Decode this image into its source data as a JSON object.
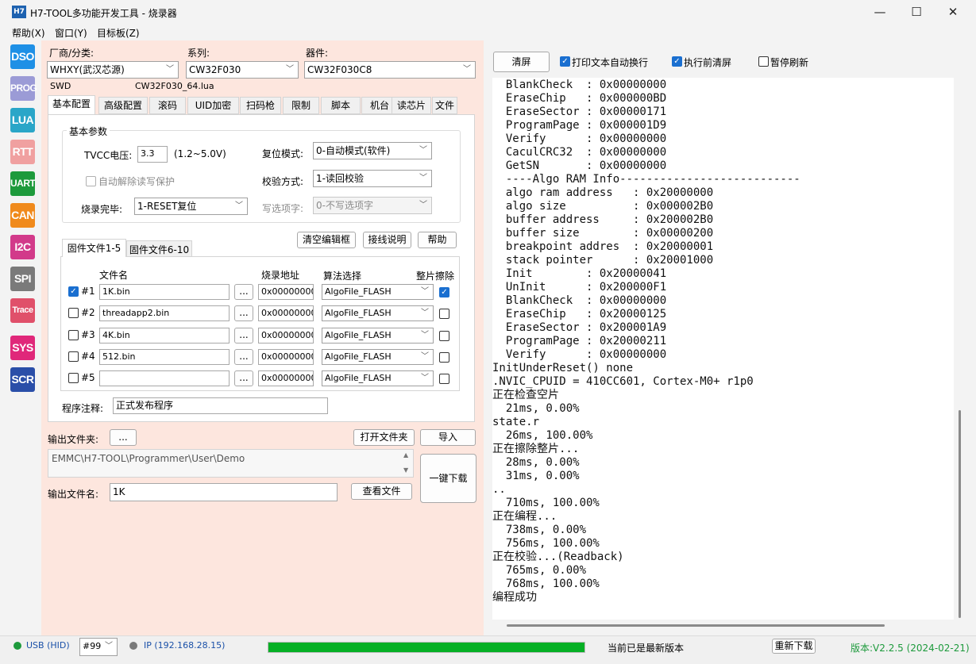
{
  "window": {
    "app_icon": "H7",
    "title": "H7-TOOL多功能开发工具 - 烧录器",
    "minimize": "—",
    "maximize": "☐",
    "close": "✕"
  },
  "menu": [
    "帮助(X)",
    "窗口(Y)",
    "目标板(Z)"
  ],
  "side_buttons": [
    {
      "label": "DSO",
      "color": "#1e90e6"
    },
    {
      "label": "PROG",
      "color": "#9b9bd6"
    },
    {
      "label": "LUA",
      "color": "#2aa6c8"
    },
    {
      "label": "RTT",
      "color": "#f0a0a0"
    },
    {
      "label": "UART",
      "color": "#1d9a3c"
    },
    {
      "label": "CAN",
      "color": "#f08a1c"
    },
    {
      "label": "I2C",
      "color": "#d23a8a"
    },
    {
      "label": "SPI",
      "color": "#7a7a7a"
    },
    {
      "label": "Trace",
      "color": "#e0506a"
    },
    {
      "label": "SYS",
      "color": "#e0287a"
    },
    {
      "label": "SCR",
      "color": "#2a4ea8"
    }
  ],
  "top": {
    "vendor_label": "厂商/分类:",
    "vendor_value": "WHXY(武汉芯源)",
    "series_label": "系列:",
    "series_value": "CW32F030",
    "device_label": "器件:",
    "device_value": "CW32F030C8",
    "interface": "SWD",
    "lua_file": "CW32F030_64.lua"
  },
  "tabs": [
    "基本配置",
    "高级配置",
    "滚码",
    "UID加密",
    "扫码枪",
    "限制",
    "脚本",
    "机台",
    "读芯片",
    "文件"
  ],
  "basic": {
    "group_title": "基本参数",
    "tvcc_label": "TVCC电压:",
    "tvcc_value": "3.3",
    "tvcc_range": "(1.2~5.0V)",
    "auto_unprotect": "自动解除读写保护",
    "done_label": "烧录完毕:",
    "done_value": "1-RESET复位",
    "reset_label": "复位模式:",
    "reset_value": "0-自动模式(软件)",
    "verify_label": "校验方式:",
    "verify_value": "1-读回校验",
    "option_label": "写选项字:",
    "option_value": "0-不写选项字"
  },
  "actions": {
    "clear_buf": "清空编辑框",
    "wiring": "接线说明",
    "help": "帮助"
  },
  "fw_tabs": [
    "固件文件1-5",
    "固件文件6-10"
  ],
  "fw_headers": {
    "name": "文件名",
    "addr": "烧录地址",
    "algo": "算法选择",
    "erase": "整片擦除"
  },
  "fw_rows": [
    {
      "id": "#1",
      "enabled": true,
      "file": "1K.bin",
      "browse": "...",
      "addr": "0x00000000",
      "algo": "AlgoFile_FLASH",
      "erase": true
    },
    {
      "id": "#2",
      "enabled": false,
      "file": "threadapp2.bin",
      "browse": "...",
      "addr": "0x00000000",
      "algo": "AlgoFile_FLASH",
      "erase": false
    },
    {
      "id": "#3",
      "enabled": false,
      "file": "4K.bin",
      "browse": "...",
      "addr": "0x00000000",
      "algo": "AlgoFile_FLASH",
      "erase": false
    },
    {
      "id": "#4",
      "enabled": false,
      "file": "512.bin",
      "browse": "...",
      "addr": "0x00000000",
      "algo": "AlgoFile_FLASH",
      "erase": false
    },
    {
      "id": "#5",
      "enabled": false,
      "file": "",
      "browse": "...",
      "addr": "0x00000000",
      "algo": "AlgoFile_FLASH",
      "erase": false
    }
  ],
  "note_label": "程序注释:",
  "note_value": "正式发布程序",
  "output": {
    "folder_label": "输出文件夹:",
    "folder_btn": "...",
    "open_folder": "打开文件夹",
    "import": "导入",
    "path": "EMMC\\H7-TOOL\\Programmer\\User\\Demo",
    "one_click": "一键下载",
    "file_label": "输出文件名:",
    "file_value": "1K",
    "view_file": "查看文件"
  },
  "console_toolbar": {
    "clear": "清屏",
    "wrap": "打印文本自动换行",
    "wrap_on": true,
    "clear_before": "执行前清屏",
    "clear_before_on": true,
    "pause": "暂停刷新",
    "pause_on": false
  },
  "console_lines": [
    "  BlankCheck  : 0x00000000",
    "  EraseChip   : 0x000000BD",
    "  EraseSector : 0x00000171",
    "  ProgramPage : 0x000001D9",
    "  Verify      : 0x00000000",
    "  CaculCRC32  : 0x00000000",
    "  GetSN       : 0x00000000",
    "  ----Algo RAM Info---------------------------",
    "  algo ram address   : 0x20000000",
    "  algo size          : 0x000002B0",
    "  buffer address     : 0x200002B0",
    "  buffer size        : 0x00000200",
    "  breakpoint addres  : 0x20000001",
    "  stack pointer      : 0x20001000",
    "  Init        : 0x20000041",
    "  UnInit      : 0x200000F1",
    "  BlankCheck  : 0x00000000",
    "  EraseChip   : 0x20000125",
    "  EraseSector : 0x200001A9",
    "  ProgramPage : 0x20000211",
    "  Verify      : 0x00000000",
    "InitUnderReset() none",
    ".NVIC_CPUID = 410CC601, Cortex-M0+ r1p0",
    "正在检查空片",
    "  21ms, 0.00%",
    "state.r",
    "  26ms, 100.00%",
    "正在擦除整片...",
    "  28ms, 0.00%",
    "  31ms, 0.00%",
    "..",
    "  710ms, 100.00%",
    "正在编程...",
    "  738ms, 0.00%",
    "  756ms, 100.00%",
    "正在校验...(Readback)",
    "  765ms, 0.00%",
    "  768ms, 100.00%",
    "编程成功"
  ],
  "status": {
    "usb": "USB (HID)",
    "usb_color": "#1d9a3c",
    "dev_id": "#99",
    "ip": "IP (192.168.28.15)",
    "ip_color": "#7a7a7a",
    "progress_percent": 100,
    "progress_color": "#06b025",
    "update_msg": "当前已是最新版本",
    "redownload": "重新下载",
    "version": "版本:V2.2.5 (2024-02-21)"
  }
}
